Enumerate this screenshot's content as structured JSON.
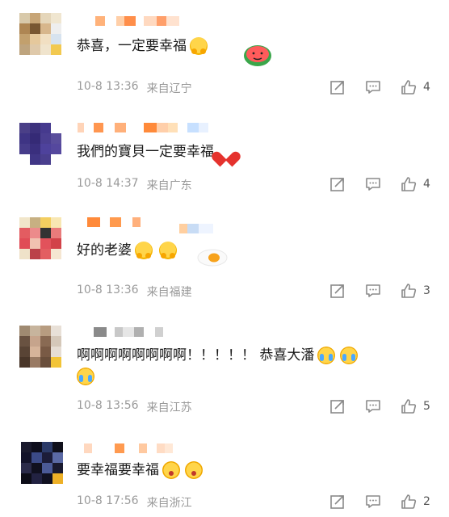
{
  "comments": [
    {
      "text": "恭喜，一定要幸福",
      "time": "10-8 13:36",
      "location": "来自辽宁",
      "likes": "4",
      "emojis": [
        "hug-emoji"
      ],
      "sticker": "watermelon-sticker"
    },
    {
      "text": "我們的寶貝一定要幸福",
      "time": "10-8 14:37",
      "location": "来自广东",
      "likes": "4",
      "emojis": [
        "heart-emoji"
      ]
    },
    {
      "text": "好的老婆",
      "time": "10-8 13:36",
      "location": "来自福建",
      "likes": "3",
      "emojis": [
        "pleading-emoji",
        "pleading-emoji"
      ],
      "sticker": "egg-sticker"
    },
    {
      "text": "啊啊啊啊啊啊啊啊！！！！！ 恭喜大潘",
      "time": "10-8 13:56",
      "location": "来自江苏",
      "likes": "5",
      "emojis": [
        "crying-laugh-emoji",
        "crying-laugh-emoji",
        "crying-laugh-emoji"
      ]
    },
    {
      "text": "要幸福要幸福",
      "time": "10-8 17:56",
      "location": "来自浙江",
      "likes": "2",
      "emojis": [
        "scream-emoji",
        "scream-emoji"
      ]
    }
  ],
  "icons": {
    "repost": "repost-icon",
    "comment": "comment-icon",
    "like": "thumbs-up-icon"
  },
  "colors": {
    "meta": "#9a9a9a",
    "icon": "#8a8a8a",
    "heart": "#e5322d"
  }
}
